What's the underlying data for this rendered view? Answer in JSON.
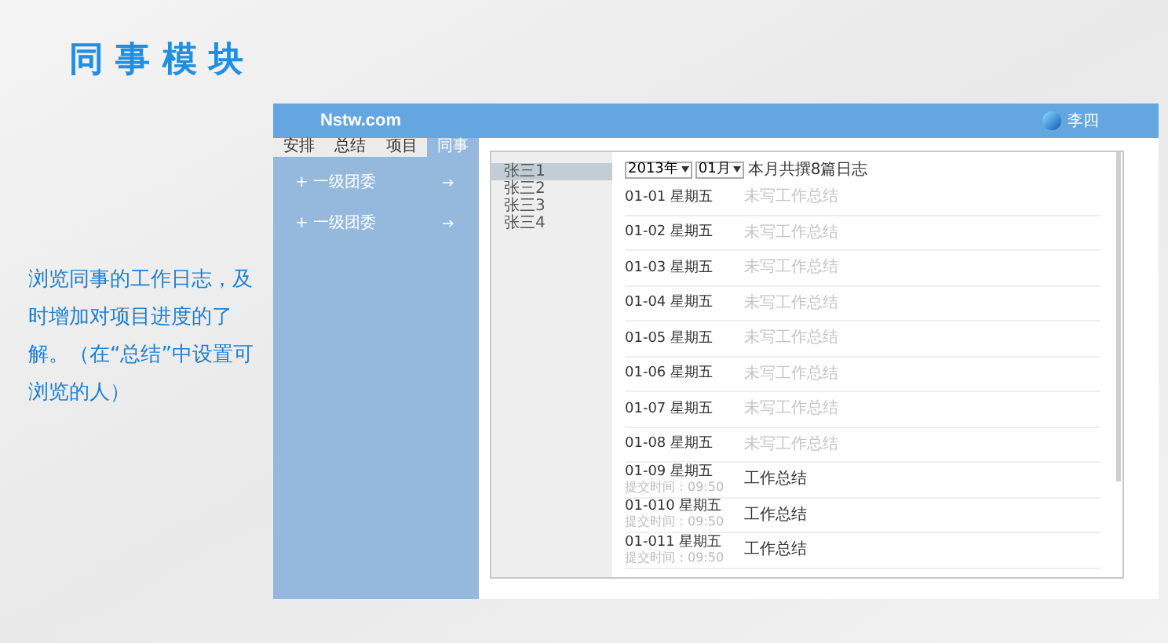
{
  "slide_title": "同 事 模 块",
  "description": "浏览同事的工作日志，及时增加对项目进度的了解。（在“总结”中设置可浏览的人）",
  "app": {
    "logo": "Nstw.com",
    "user": "李四",
    "tabs": [
      {
        "label": "安排",
        "selected": false
      },
      {
        "label": "总结",
        "selected": false
      },
      {
        "label": "项目",
        "selected": false
      },
      {
        "label": "同事",
        "selected": true
      }
    ],
    "groups": [
      {
        "label": "+ 一级团委"
      },
      {
        "label": "+ 一级团委"
      }
    ],
    "colleagues": [
      {
        "name": "张三1",
        "selected": true
      },
      {
        "name": "张三2",
        "selected": false
      },
      {
        "name": "张三3",
        "selected": false
      },
      {
        "name": "张三4",
        "selected": false
      }
    ],
    "filters": {
      "year": "2013年",
      "month": "01月",
      "summary": "本月共撰8篇日志"
    },
    "entries": [
      {
        "kind": "empty",
        "date": "01-01 星期五",
        "status": "未写工作总结"
      },
      {
        "kind": "empty",
        "date": "01-02 星期五",
        "status": "未写工作总结"
      },
      {
        "kind": "empty",
        "date": "01-03 星期五",
        "status": "未写工作总结"
      },
      {
        "kind": "empty",
        "date": "01-04 星期五",
        "status": "未写工作总结"
      },
      {
        "kind": "empty",
        "date": "01-05 星期五",
        "status": "未写工作总结"
      },
      {
        "kind": "empty",
        "date": "01-06 星期五",
        "status": "未写工作总结"
      },
      {
        "kind": "empty",
        "date": "01-07 星期五",
        "status": "未写工作总结"
      },
      {
        "kind": "empty",
        "date": "01-08 星期五",
        "status": "未写工作总结"
      },
      {
        "kind": "submitted",
        "date": "01-09 星期五",
        "time": "提交时间：09:50",
        "status": "工作总结"
      },
      {
        "kind": "submitted",
        "date": "01-010 星期五",
        "time": "提交时间：09:50",
        "status": "工作总结"
      },
      {
        "kind": "submitted",
        "date": "01-011 星期五",
        "time": "提交时间：09:50",
        "status": "工作总结"
      }
    ]
  }
}
